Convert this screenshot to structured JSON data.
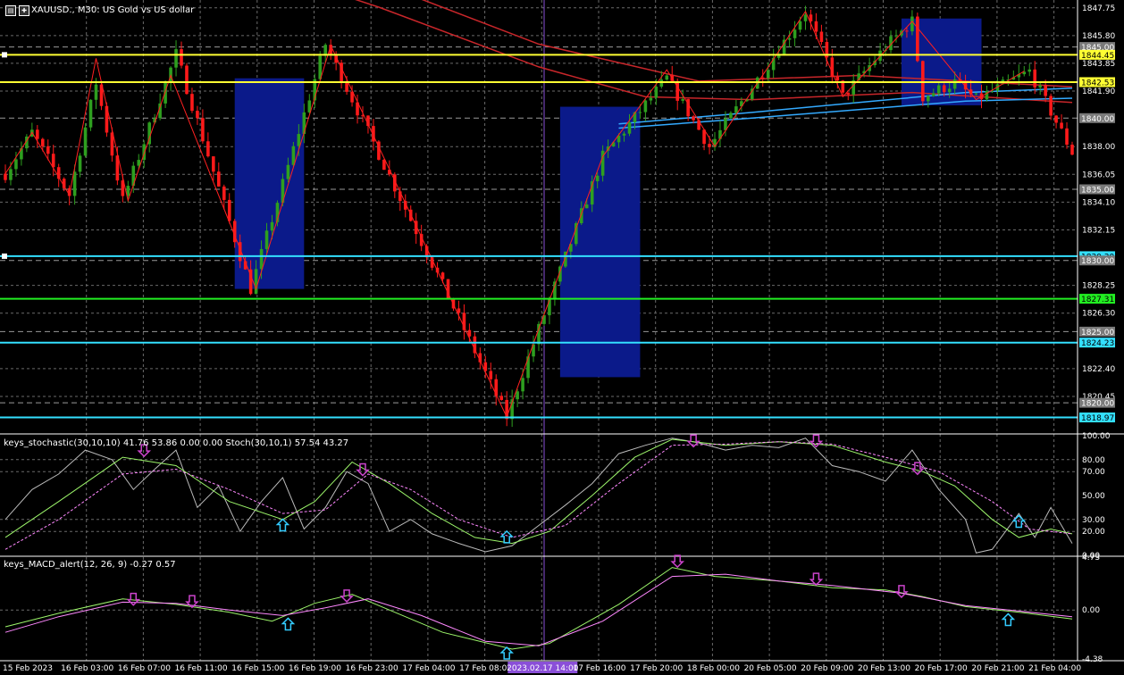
{
  "header": {
    "symbol_text": "XAUUSD., M30: US Gold vs US dollar",
    "stoch_label": "keys_stochastic(30,10,10) 41.76 53.86 0.00 0.00 Stoch(30,10,1) 57.54 43.27",
    "macd_label": "keys_MACD_alert(12, 26, 9) -0.27 0.57"
  },
  "colors": {
    "background": "#000000",
    "bull": "#2e9f1f",
    "bear": "#ff1a1a",
    "zigzag": "#ff2020",
    "box": "#0b1a8a",
    "ma_red": "#c8262a",
    "ma_blue": "#33aaff",
    "yellow": "#ffff33",
    "cyan": "#33e0ff",
    "green": "#22ee22",
    "grid": "#6a6a6a",
    "vline": "#8a4fd8",
    "stoch_gray": "#bbbbbb",
    "stoch_green": "#9cf56a",
    "stoch_pink": "#ff88ff",
    "arrow_up": "#33ccff",
    "arrow_down": "#cc44cc"
  },
  "chart_data": {
    "type": "candlestick",
    "price_range": [
      1818.0,
      1848.3
    ],
    "price_ticks": [
      "1847.75",
      "1845.80",
      "1843.85",
      "1841.90",
      "1838.00",
      "1836.05",
      "1834.10",
      "1832.15",
      "1828.25",
      "1826.30",
      "1822.40",
      "1820.45"
    ],
    "price_tick_values": [
      1847.75,
      1845.8,
      1843.85,
      1841.9,
      1838.0,
      1836.05,
      1834.1,
      1832.15,
      1828.25,
      1826.3,
      1822.4,
      1820.45
    ],
    "price_labels": [
      {
        "value": 1845.0,
        "text": "1845.00",
        "style": "gray"
      },
      {
        "value": 1844.45,
        "text": "1844.45",
        "style": "yellow"
      },
      {
        "value": 1842.53,
        "text": "1842.53",
        "style": "yellow"
      },
      {
        "value": 1840.0,
        "text": "1840.00",
        "style": "gray"
      },
      {
        "value": 1835.0,
        "text": "1835.00",
        "style": "gray"
      },
      {
        "value": 1830.3,
        "text": "1830.30",
        "style": "cyan"
      },
      {
        "value": 1830.0,
        "text": "1830.00",
        "style": "gray"
      },
      {
        "value": 1827.31,
        "text": "1827.31",
        "style": "green"
      },
      {
        "value": 1825.0,
        "text": "1825.00",
        "style": "gray"
      },
      {
        "value": 1824.23,
        "text": "1824.23",
        "style": "cyan"
      },
      {
        "value": 1820.0,
        "text": "1820.00",
        "style": "gray"
      },
      {
        "value": 1818.97,
        "text": "1818.97",
        "style": "cyan"
      }
    ],
    "hlines": [
      {
        "value": 1844.45,
        "color": "yellow"
      },
      {
        "value": 1842.53,
        "color": "yellow"
      },
      {
        "value": 1830.3,
        "color": "cyan"
      },
      {
        "value": 1827.31,
        "color": "green"
      },
      {
        "value": 1824.23,
        "color": "cyan"
      },
      {
        "value": 1818.97,
        "color": "cyan"
      }
    ],
    "dashed_levels": [
      1845.0,
      1840.0,
      1835.0,
      1830.0,
      1825.0,
      1820.0
    ],
    "time_labels": [
      "15 Feb 2023",
      "16 Feb 03:00",
      "16 Feb 07:00",
      "16 Feb 11:00",
      "16 Feb 15:00",
      "16 Feb 19:00",
      "16 Feb 23:00",
      "17 Feb 04:00",
      "17 Feb 08:00",
      "2023.02.17 14:00",
      "17 Feb 16:00",
      "17 Feb 20:00",
      "18 Feb 00:00",
      "20 Feb 05:00",
      "20 Feb 09:00",
      "20 Feb 13:00",
      "20 Feb 17:00",
      "20 Feb 21:00",
      "21 Feb 04:00"
    ],
    "highlight_time_index": 9,
    "key_points": [
      [
        0,
        1836.1
      ],
      [
        5,
        1839.0
      ],
      [
        12,
        1834.6
      ],
      [
        17,
        1842.5
      ],
      [
        22,
        1834.2
      ],
      [
        32,
        1844.5
      ],
      [
        46,
        1828.0
      ],
      [
        60,
        1845.2
      ],
      [
        94,
        1819.0
      ],
      [
        100,
        1825.2
      ],
      [
        112,
        1837.3
      ],
      [
        124,
        1842.8
      ],
      [
        132,
        1838.0
      ],
      [
        140,
        1842.2
      ],
      [
        150,
        1847.5
      ],
      [
        157,
        1841.5
      ],
      [
        165,
        1845.0
      ],
      [
        170,
        1846.8
      ],
      [
        172,
        1841.5
      ],
      [
        178,
        1842.5
      ],
      [
        182,
        1841.3
      ],
      [
        192,
        1843.3
      ],
      [
        200,
        1837.6
      ]
    ],
    "zigzag": [
      [
        0,
        1836.1
      ],
      [
        5,
        1839.0
      ],
      [
        12,
        1834.6
      ],
      [
        17,
        1844.2
      ],
      [
        23,
        1834.2
      ],
      [
        31,
        1843.0
      ],
      [
        47,
        1828.0
      ],
      [
        61,
        1845.1
      ],
      [
        94,
        1819.0
      ],
      [
        100,
        1825.2
      ],
      [
        112,
        1837.3
      ],
      [
        124,
        1843.4
      ],
      [
        133,
        1838.0
      ],
      [
        150,
        1847.5
      ],
      [
        157,
        1841.5
      ],
      [
        170,
        1846.8
      ],
      [
        182,
        1841.3
      ],
      [
        191,
        1843.3
      ]
    ],
    "boxes": [
      {
        "from": 43,
        "to": 56,
        "low": 1828.0,
        "high": 1842.8
      },
      {
        "from": 104,
        "to": 119,
        "low": 1821.8,
        "high": 1840.8
      },
      {
        "from": 168,
        "to": 183,
        "low": 1840.9,
        "high": 1847.0
      }
    ],
    "ma_red_1": [
      [
        0,
        1858
      ],
      [
        40,
        1853.5
      ],
      [
        70,
        1849.5
      ],
      [
        100,
        1845.2
      ],
      [
        130,
        1842.6
      ],
      [
        160,
        1843.0
      ],
      [
        200,
        1842.2
      ]
    ],
    "ma_red_2": [
      [
        0,
        1856
      ],
      [
        40,
        1851.5
      ],
      [
        70,
        1847.8
      ],
      [
        100,
        1843.6
      ],
      [
        120,
        1841.5
      ],
      [
        140,
        1841.3
      ],
      [
        170,
        1841.8
      ],
      [
        200,
        1841.1
      ]
    ],
    "ma_blue_1": [
      [
        115,
        1839.6
      ],
      [
        140,
        1840.4
      ],
      [
        160,
        1841.1
      ],
      [
        180,
        1841.8
      ],
      [
        200,
        1842.1
      ]
    ],
    "ma_blue_2": [
      [
        115,
        1839.3
      ],
      [
        140,
        1840.0
      ],
      [
        160,
        1840.6
      ],
      [
        180,
        1841.2
      ],
      [
        200,
        1841.4
      ]
    ],
    "stoch": {
      "range": [
        0,
        100
      ],
      "ticks": [
        "100.00",
        "80.00",
        "70.00",
        "50.00",
        "30.00",
        "20.00",
        "0.00"
      ],
      "tick_values": [
        100,
        80,
        70,
        50,
        30,
        20,
        0
      ],
      "dashed_levels": [
        80,
        70,
        30,
        20
      ],
      "gray": [
        [
          0,
          30
        ],
        [
          5,
          55
        ],
        [
          10,
          68
        ],
        [
          15,
          88
        ],
        [
          20,
          80
        ],
        [
          24,
          55
        ],
        [
          28,
          72
        ],
        [
          32,
          88
        ],
        [
          36,
          40
        ],
        [
          40,
          58
        ],
        [
          44,
          20
        ],
        [
          48,
          45
        ],
        [
          52,
          65
        ],
        [
          56,
          22
        ],
        [
          60,
          40
        ],
        [
          64,
          70
        ],
        [
          68,
          60
        ],
        [
          72,
          20
        ],
        [
          76,
          30
        ],
        [
          80,
          18
        ],
        [
          85,
          10
        ],
        [
          90,
          3
        ],
        [
          95,
          8
        ],
        [
          100,
          25
        ],
        [
          105,
          42
        ],
        [
          110,
          60
        ],
        [
          115,
          85
        ],
        [
          120,
          92
        ],
        [
          125,
          98
        ],
        [
          130,
          94
        ],
        [
          135,
          88
        ],
        [
          140,
          92
        ],
        [
          145,
          90
        ],
        [
          150,
          98
        ],
        [
          155,
          75
        ],
        [
          160,
          70
        ],
        [
          165,
          62
        ],
        [
          170,
          88
        ],
        [
          175,
          55
        ],
        [
          180,
          30
        ],
        [
          182,
          2
        ],
        [
          185,
          5
        ],
        [
          190,
          35
        ],
        [
          193,
          15
        ],
        [
          196,
          40
        ],
        [
          200,
          10
        ]
      ],
      "green": [
        [
          0,
          15
        ],
        [
          10,
          45
        ],
        [
          22,
          82
        ],
        [
          32,
          75
        ],
        [
          42,
          45
        ],
        [
          52,
          30
        ],
        [
          58,
          45
        ],
        [
          65,
          78
        ],
        [
          72,
          60
        ],
        [
          80,
          35
        ],
        [
          88,
          15
        ],
        [
          95,
          10
        ],
        [
          102,
          20
        ],
        [
          110,
          50
        ],
        [
          118,
          82
        ],
        [
          125,
          97
        ],
        [
          135,
          92
        ],
        [
          145,
          95
        ],
        [
          155,
          92
        ],
        [
          165,
          78
        ],
        [
          172,
          70
        ],
        [
          178,
          58
        ],
        [
          185,
          30
        ],
        [
          190,
          15
        ],
        [
          196,
          22
        ],
        [
          200,
          18
        ]
      ],
      "pink": [
        [
          0,
          5
        ],
        [
          10,
          30
        ],
        [
          22,
          68
        ],
        [
          32,
          72
        ],
        [
          42,
          55
        ],
        [
          52,
          35
        ],
        [
          60,
          38
        ],
        [
          68,
          68
        ],
        [
          76,
          55
        ],
        [
          85,
          30
        ],
        [
          95,
          15
        ],
        [
          105,
          25
        ],
        [
          115,
          60
        ],
        [
          125,
          92
        ],
        [
          135,
          93
        ],
        [
          145,
          95
        ],
        [
          155,
          93
        ],
        [
          165,
          82
        ],
        [
          175,
          70
        ],
        [
          185,
          45
        ],
        [
          192,
          22
        ],
        [
          200,
          18
        ]
      ],
      "arrows": [
        {
          "i": 26,
          "dir": "down",
          "v": 88
        },
        {
          "i": 52,
          "dir": "up",
          "v": 25
        },
        {
          "i": 67,
          "dir": "down",
          "v": 72
        },
        {
          "i": 94,
          "dir": "up",
          "v": 15
        },
        {
          "i": 129,
          "dir": "down",
          "v": 96
        },
        {
          "i": 152,
          "dir": "down",
          "v": 96
        },
        {
          "i": 171,
          "dir": "down",
          "v": 73
        },
        {
          "i": 190,
          "dir": "up",
          "v": 28
        }
      ]
    },
    "macd": {
      "range": [
        -4.38,
        4.73
      ],
      "ticks": [
        "4.73",
        "0.00",
        "-4.38"
      ],
      "tick_values": [
        4.73,
        0.0,
        -4.38
      ],
      "dashed_levels": [
        0.0
      ],
      "green": [
        [
          0,
          -1.5
        ],
        [
          10,
          -0.3
        ],
        [
          22,
          1.0
        ],
        [
          32,
          0.5
        ],
        [
          42,
          -0.2
        ],
        [
          50,
          -1.0
        ],
        [
          58,
          0.6
        ],
        [
          65,
          1.4
        ],
        [
          72,
          0.0
        ],
        [
          82,
          -2.0
        ],
        [
          95,
          -3.5
        ],
        [
          102,
          -3.0
        ],
        [
          115,
          0.5
        ],
        [
          125,
          3.8
        ],
        [
          133,
          3.0
        ],
        [
          145,
          2.6
        ],
        [
          155,
          2.0
        ],
        [
          165,
          1.8
        ],
        [
          172,
          1.2
        ],
        [
          180,
          0.3
        ],
        [
          190,
          -0.2
        ],
        [
          200,
          -0.8
        ]
      ],
      "pink": [
        [
          0,
          -2.0
        ],
        [
          10,
          -0.6
        ],
        [
          22,
          0.7
        ],
        [
          32,
          0.6
        ],
        [
          42,
          0.0
        ],
        [
          52,
          -0.5
        ],
        [
          60,
          0.2
        ],
        [
          68,
          1.0
        ],
        [
          78,
          -0.5
        ],
        [
          90,
          -2.8
        ],
        [
          100,
          -3.2
        ],
        [
          112,
          -1.0
        ],
        [
          125,
          3.0
        ],
        [
          135,
          3.2
        ],
        [
          145,
          2.6
        ],
        [
          155,
          2.2
        ],
        [
          168,
          1.5
        ],
        [
          180,
          0.4
        ],
        [
          190,
          -0.1
        ],
        [
          200,
          -0.6
        ]
      ],
      "arrows": [
        {
          "i": 24,
          "dir": "down",
          "v": 1.0
        },
        {
          "i": 35,
          "dir": "down",
          "v": 0.8
        },
        {
          "i": 53,
          "dir": "up",
          "v": -1.3
        },
        {
          "i": 64,
          "dir": "down",
          "v": 1.3
        },
        {
          "i": 94,
          "dir": "up",
          "v": -3.9
        },
        {
          "i": 126,
          "dir": "down",
          "v": 4.4
        },
        {
          "i": 152,
          "dir": "down",
          "v": 2.8
        },
        {
          "i": 168,
          "dir": "down",
          "v": 1.7
        },
        {
          "i": 188,
          "dir": "up",
          "v": -0.9
        }
      ]
    }
  }
}
